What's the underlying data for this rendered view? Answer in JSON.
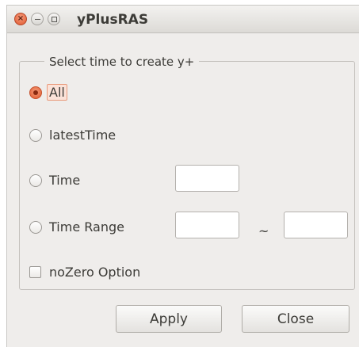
{
  "window": {
    "title": "yPlusRAS"
  },
  "group": {
    "title": "Select time to create y+"
  },
  "options": {
    "all_label": "All",
    "latest_label": "latestTime",
    "time_label": "Time",
    "range_label": "Time Range",
    "range_separator": "~",
    "nozero_label": "noZero Option"
  },
  "state": {
    "selected_option": "All",
    "nozero_checked": false
  },
  "inputs": {
    "time_value": "",
    "range_start_value": "",
    "range_end_value": ""
  },
  "buttons": {
    "apply_label": "Apply",
    "close_label": "Close"
  },
  "colors": {
    "accent": "#e05a2e",
    "window_bg": "#efedeb"
  }
}
